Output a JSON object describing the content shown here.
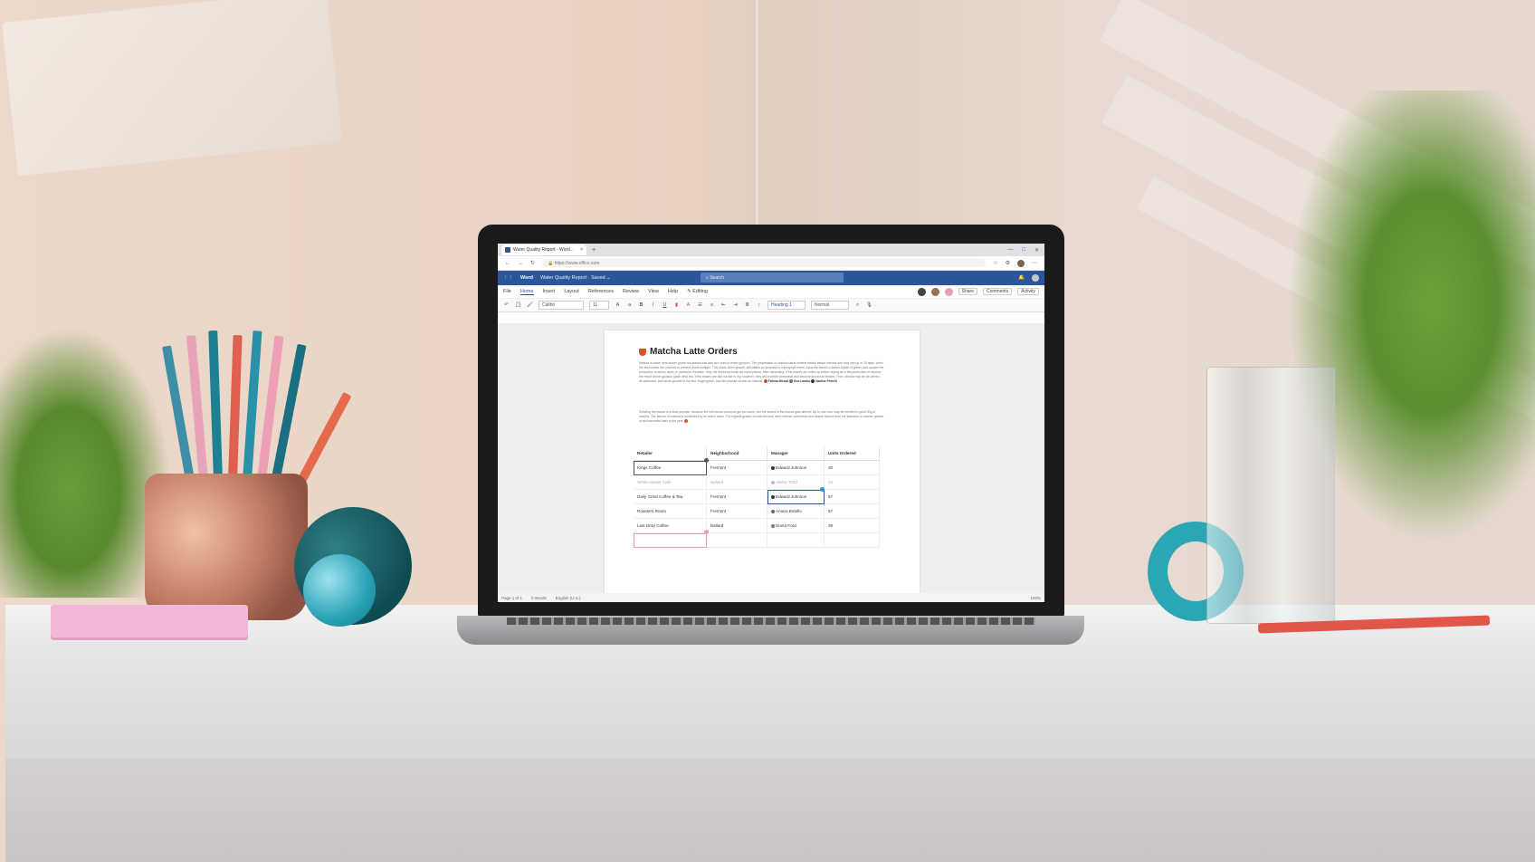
{
  "browser": {
    "tab_title": "Water Quality Report - Word...",
    "tab_close": "×",
    "tab_new": "+",
    "window_controls": [
      "—",
      "□",
      "✕"
    ],
    "url": "https://www.office.com"
  },
  "app": {
    "name": "Word",
    "doc_title": "Water Quality Report · Saved ⌄",
    "search_placeholder": "Search"
  },
  "menu": {
    "items": [
      "File",
      "Home",
      "Insert",
      "Layout",
      "References",
      "Review",
      "View",
      "Help"
    ],
    "editing": "Editing",
    "share": "Share",
    "comments": "Comments",
    "activity": "Activity"
  },
  "toolbar": {
    "font": "Calibri",
    "size": "11",
    "style_heading": "Heading 1",
    "style_normal": "Normal"
  },
  "document": {
    "title": "Matcha Latte Orders",
    "para1": "Matcha is made from shade-grown tea leaves that also are used to make gyokuro. The preparation of matcha starts several weeks before harvest and may last up to 20 days, when the tea bushes are covered to prevent direct sunlight. This slows down growth, stimulates an increase in chlorophyll levels, turns the leaves a darker shade of green, and causes the production of amino acids, in particular theanine. Only the finest tea buds are hand-picked. After harvesting, if the leaves are rolled up before drying as in the production of sencha, the result will be gyokuro (jade dew) tea. If the leaves are laid out flat to dry, however, they will crumble somewhat and become known as tencha. Then, tencha may be de-veined, de-stemmed, and stone-ground to the fine, bright green, talc-like powder known as matcha.",
    "mentions": [
      "Fatima Mirzaii",
      "Eva Lambo",
      "Nadine Petrelli"
    ],
    "para2": "Grinding the leaves is a slow process, because the mill stones must not get too warm, lest the aroma of the leaves gets altered. Up to one hour may be needed to grind 30g of matcha. The flavour of matcha is dominated by its amino acids. The highest grades of matcha have more intense sweetness and deeper flavour than the standard or coarser grades of tea harvested later in the year.",
    "table": {
      "headers": [
        "Retailer",
        "Neighborhood",
        "Manager",
        "Units Ordered"
      ],
      "rows": [
        [
          "Kings Coffee",
          "Fremont",
          "Edward Johnson",
          "30"
        ],
        [
          "White Awake Cafe",
          "Ballard",
          "Alisha Todd",
          "15"
        ],
        [
          "Daily Grind Coffee & Tea",
          "Fremont",
          "Edward Johnson",
          "57"
        ],
        [
          "Roasters Room",
          "Fremont",
          "Amara Botello",
          "57"
        ],
        [
          "Last Drop Coffee",
          "Ballard",
          "Diana Ford",
          "39"
        ],
        [
          "",
          "",
          "",
          ""
        ]
      ]
    }
  },
  "status": {
    "page": "Page 1 of 1",
    "words": "0 Words",
    "language": "English (U.S.)",
    "zoom": "100%"
  },
  "colors": {
    "word_blue": "#2b579a",
    "accent_pink": "#e79fc4",
    "accent_teal": "#2aa6b5"
  }
}
